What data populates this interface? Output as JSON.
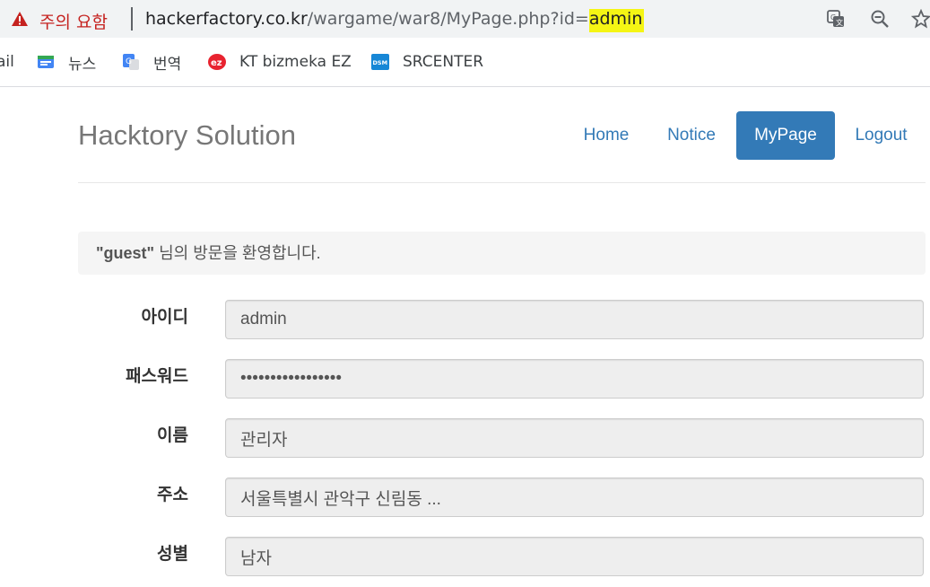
{
  "browser": {
    "security_warning": "주의 요함",
    "url_host": "hackerfactory.co.kr",
    "url_path": "/wargame/war8/MyPage.php?id=",
    "url_highlighted_param": "admin",
    "icons": [
      "translate-icon",
      "zoom-icon",
      "bookmark-star-icon"
    ]
  },
  "bookmarks": [
    {
      "label": "ail",
      "icon": "gmail-partial"
    },
    {
      "label": "뉴스",
      "icon": "google-news-icon"
    },
    {
      "label": "번역",
      "icon": "google-translate-icon"
    },
    {
      "label": "KT bizmeka EZ",
      "icon": "ez-icon"
    },
    {
      "label": "SRCENTER",
      "icon": "dsm-icon"
    }
  ],
  "site": {
    "brand": "Hacktory Solution",
    "nav": [
      {
        "label": "Home",
        "active": false
      },
      {
        "label": "Notice",
        "active": false
      },
      {
        "label": "MyPage",
        "active": true
      },
      {
        "label": "Logout",
        "active": false
      }
    ]
  },
  "welcome": {
    "user": "\"guest\"",
    "message": " 님의 방문을 환영합니다."
  },
  "form": {
    "fields": [
      {
        "label": "아이디",
        "value": "admin"
      },
      {
        "label": "패스워드",
        "value": "•••••••••••••••••"
      },
      {
        "label": "이름",
        "value": "관리자"
      },
      {
        "label": "주소",
        "value": "서울특별시 관악구 신림동 ..."
      },
      {
        "label": "성별",
        "value": "남자"
      }
    ]
  },
  "colors": {
    "warning": "#c5221f",
    "highlight": "#f5f514",
    "link": "#337ab7",
    "active_bg": "#337ab7",
    "input_bg": "#eeeeee"
  }
}
